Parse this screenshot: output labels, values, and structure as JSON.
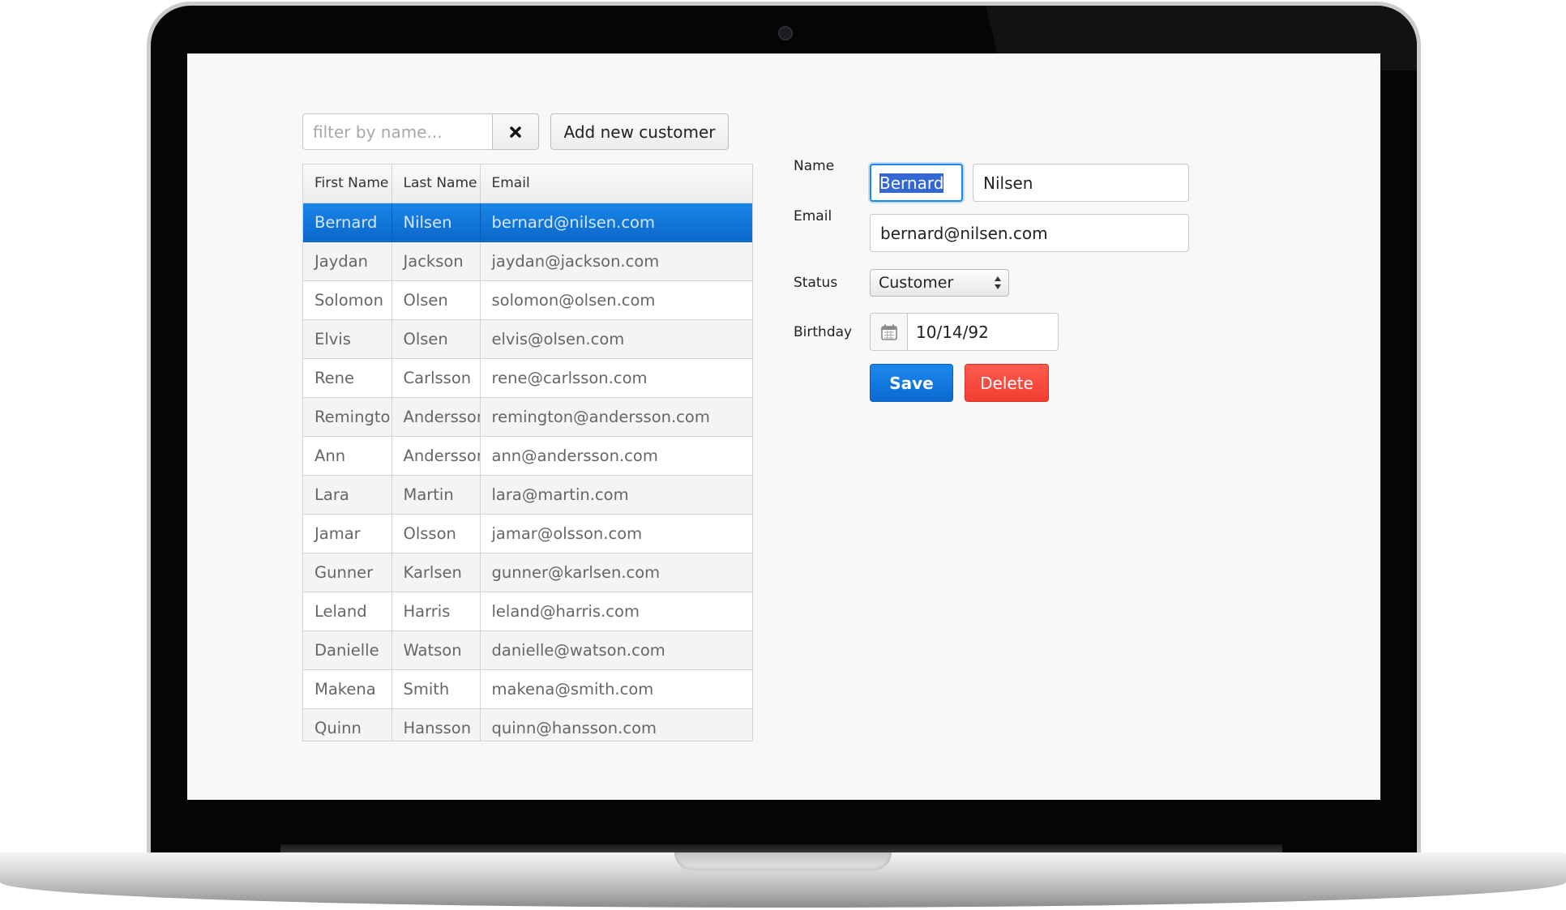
{
  "toolbar": {
    "filter_placeholder": "filter by name...",
    "filter_value": "",
    "add_label": "Add new customer"
  },
  "grid": {
    "columns": [
      "First Name",
      "Last Name",
      "Email"
    ],
    "selected_row": 0,
    "rows": [
      [
        "Bernard",
        "Nilsen",
        "bernard@nilsen.com"
      ],
      [
        "Jaydan",
        "Jackson",
        "jaydan@jackson.com"
      ],
      [
        "Solomon",
        "Olsen",
        "solomon@olsen.com"
      ],
      [
        "Elvis",
        "Olsen",
        "elvis@olsen.com"
      ],
      [
        "Rene",
        "Carlsson",
        "rene@carlsson.com"
      ],
      [
        "Remington",
        "Andersson",
        "remington@andersson.com"
      ],
      [
        "Ann",
        "Andersson",
        "ann@andersson.com"
      ],
      [
        "Lara",
        "Martin",
        "lara@martin.com"
      ],
      [
        "Jamar",
        "Olsson",
        "jamar@olsson.com"
      ],
      [
        "Gunner",
        "Karlsen",
        "gunner@karlsen.com"
      ],
      [
        "Leland",
        "Harris",
        "leland@harris.com"
      ],
      [
        "Danielle",
        "Watson",
        "danielle@watson.com"
      ],
      [
        "Makena",
        "Smith",
        "makena@smith.com"
      ],
      [
        "Quinn",
        "Hansson",
        "quinn@hansson.com"
      ]
    ]
  },
  "form": {
    "name_label": "Name",
    "first_name": "Bernard",
    "last_name": "Nilsen",
    "email_label": "Email",
    "email": "bernard@nilsen.com",
    "status_label": "Status",
    "status": "Customer",
    "birthday_label": "Birthday",
    "birthday": "10/14/92",
    "save_label": "Save",
    "delete_label": "Delete"
  },
  "colors": {
    "selection": "#0f75dd",
    "save": "#0b6fd8",
    "delete": "#f44336"
  },
  "icons": {
    "clear": "close-icon",
    "status": "updown-arrows-icon",
    "birthday": "calendar-icon"
  }
}
